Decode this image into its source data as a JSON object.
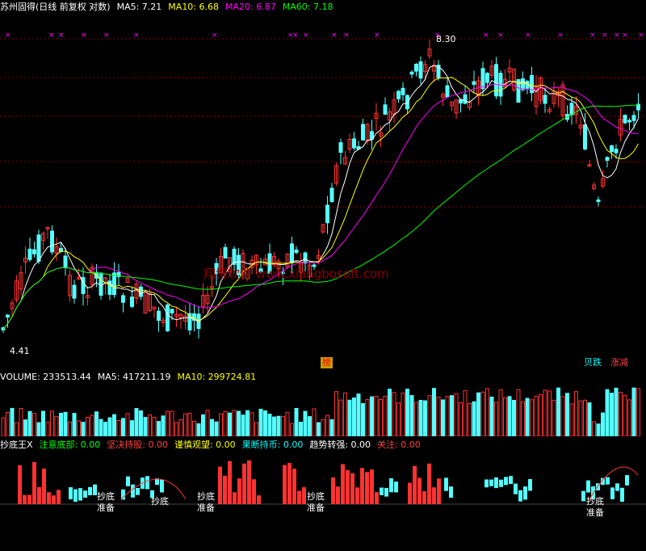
{
  "header": {
    "stock_title": "苏州固得(日线 前复权 对数)",
    "ma5_label": "MA5: 7.21",
    "ma10_label": "MA10: 6.68",
    "ma20_label": "MA20: 6.87",
    "ma60_label": "MA60: 7.18"
  },
  "colors": {
    "bg": "#000000",
    "up": "#ff3232",
    "down": "#54ffff",
    "ma5": "#ffffff",
    "ma10": "#ffff00",
    "ma20": "#ff00ff",
    "ma60": "#00ff00",
    "grid": "#8b0000"
  },
  "price_pane": {
    "high_label": "8.30",
    "low_label": "4.41",
    "watermark": "翔博软件 www.xiangbosoft.com",
    "marker_top_left": "榜",
    "marker_right_1": "贝跌",
    "marker_right_2": "涨减"
  },
  "volume_pane": {
    "volume_label": "VOLUME: 233513.44",
    "ma5_label": "MA5: 417211.19",
    "ma10_label": "MA10: 299724.81"
  },
  "indicator_pane": {
    "name": "抄底王X",
    "f1": "注意底部: 0.00",
    "f2": "坚决持股: 0.00",
    "f3": "谨慎观望: 0.00",
    "f4": "果断持币: 0.00",
    "f5": "趋势转强: 0.00",
    "f6": "关注: 0.00",
    "signal_1": "抄底准备",
    "signal_2": "抄底",
    "signal_3": "抄底准备",
    "signal_4": "抄底准备",
    "signal_5": "抄底准备"
  }
}
